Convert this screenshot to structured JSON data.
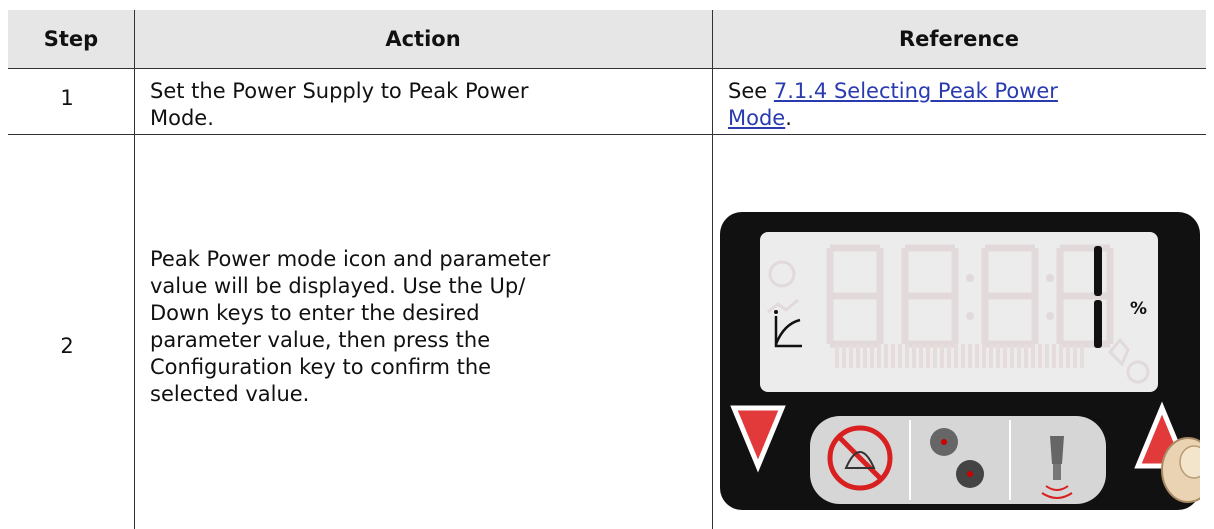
{
  "table": {
    "headers": [
      "Step",
      "Action",
      "Reference"
    ],
    "rows": [
      {
        "step": "1",
        "action_lines": [
          "Set the Power Supply to Peak Power",
          "Mode."
        ],
        "reference_prefix": "See ",
        "reference_link_lines": [
          "7.1.4 Selecting Peak Power",
          "Mode"
        ],
        "reference_suffix": "."
      },
      {
        "step": "2",
        "action_lines": [
          "Peak Power mode icon and parameter",
          "value will be displayed. Use the Up/",
          "Down keys to enter the desired",
          "parameter value, then press the",
          "Configuration key to confirm the",
          "selected value."
        ]
      }
    ]
  },
  "device": {
    "display_digit": "1",
    "unit": "%",
    "colors": {
      "bezel": "#111111",
      "lcd": "#ececec",
      "arrow": "#e23a3a",
      "keypad": "#d6d6d6",
      "ghost": "#e2dada"
    }
  }
}
